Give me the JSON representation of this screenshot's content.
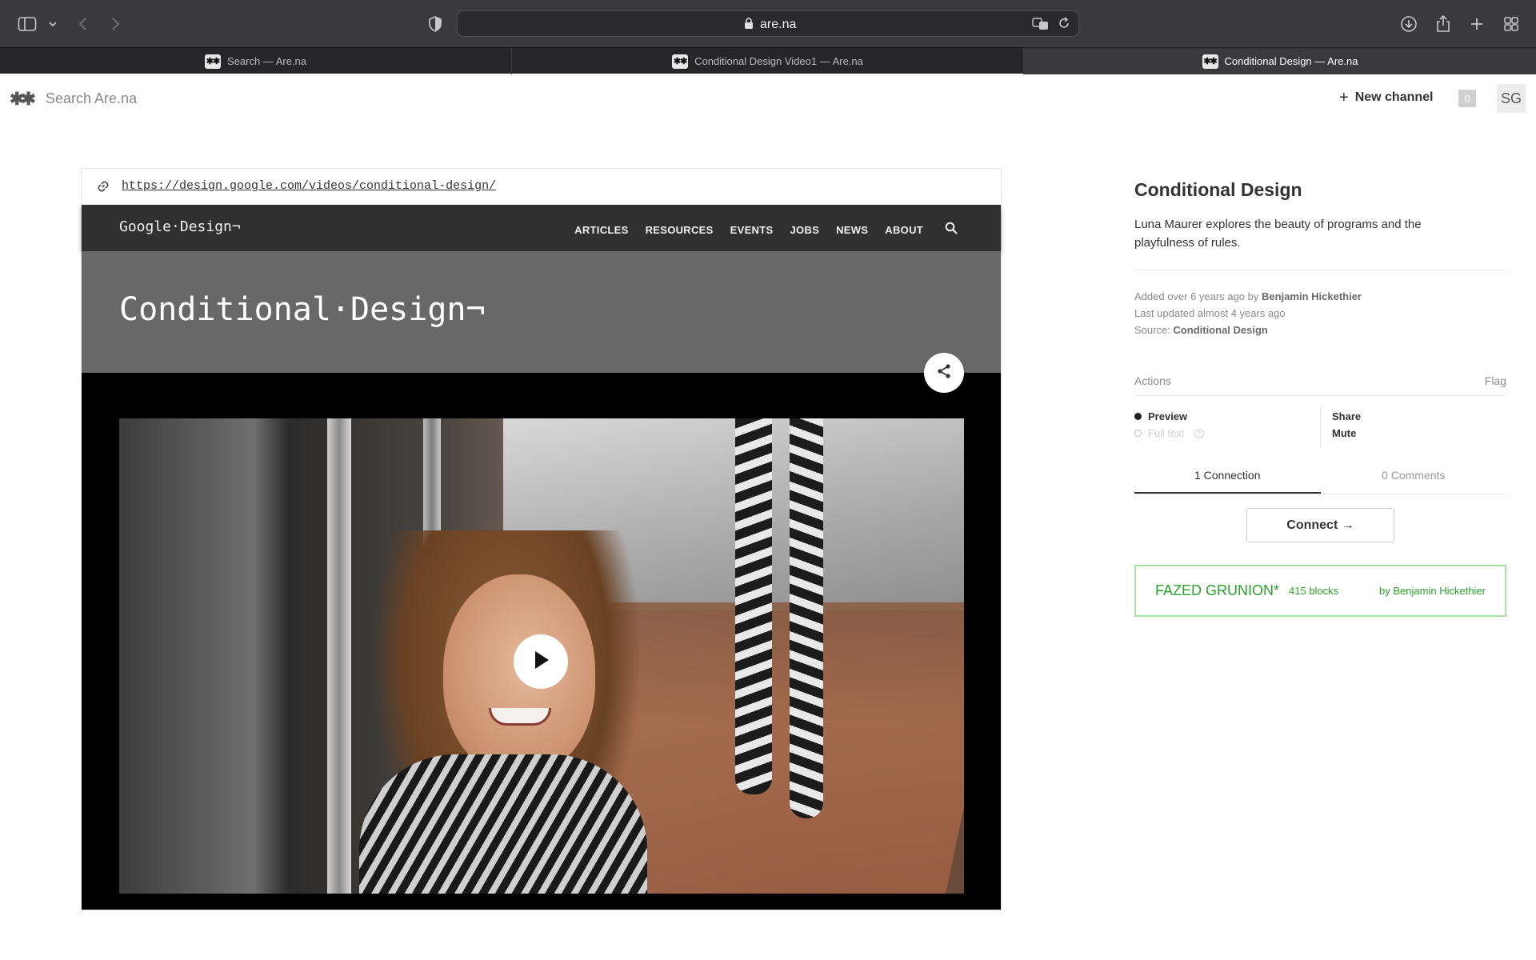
{
  "browser": {
    "url_host": "are.na",
    "tabs": [
      {
        "label": "Search — Are.na",
        "active": false
      },
      {
        "label": "Conditional Design Video1 — Are.na",
        "active": false
      },
      {
        "label": "Conditional Design — Are.na",
        "active": true
      }
    ],
    "favicon_glyph": "✱✱"
  },
  "header": {
    "logo_glyph": "✱✱",
    "search_placeholder": "Search Are.na",
    "new_channel_label": "New channel",
    "new_channel_icon": "+",
    "notification_count": "0",
    "avatar_initials": "SG"
  },
  "block": {
    "source_url": "https://design.google.com/videos/conditional-design/",
    "embed": {
      "brand": "Google·Design¬",
      "nav": [
        "ARTICLES",
        "RESOURCES",
        "EVENTS",
        "JOBS",
        "NEWS",
        "ABOUT"
      ],
      "hero_title": "Conditional·Design¬"
    }
  },
  "sidebar": {
    "title": "Conditional Design",
    "description": "Luna Maurer explores the beauty of programs and the playfulness of rules.",
    "meta": {
      "added_prefix": "Added over 6 years ago by ",
      "added_by": "Benjamin Hickethier",
      "updated": "Last updated almost 4 years ago",
      "source_prefix": "Source: ",
      "source": "Conditional Design"
    },
    "actions_label": "Actions",
    "flag_label": "Flag",
    "view_options": {
      "preview": "Preview",
      "full_text": "Full text",
      "help": "?"
    },
    "share_label": "Share",
    "mute_label": "Mute",
    "tabs": {
      "connections": "1 Connection",
      "comments": "0 Comments"
    },
    "connect_label": "Connect →",
    "channel": {
      "name": "FAZED GRUNION*",
      "count": "415 blocks",
      "by": "by Benjamin Hickethier",
      "color": "#2aa22a"
    }
  }
}
